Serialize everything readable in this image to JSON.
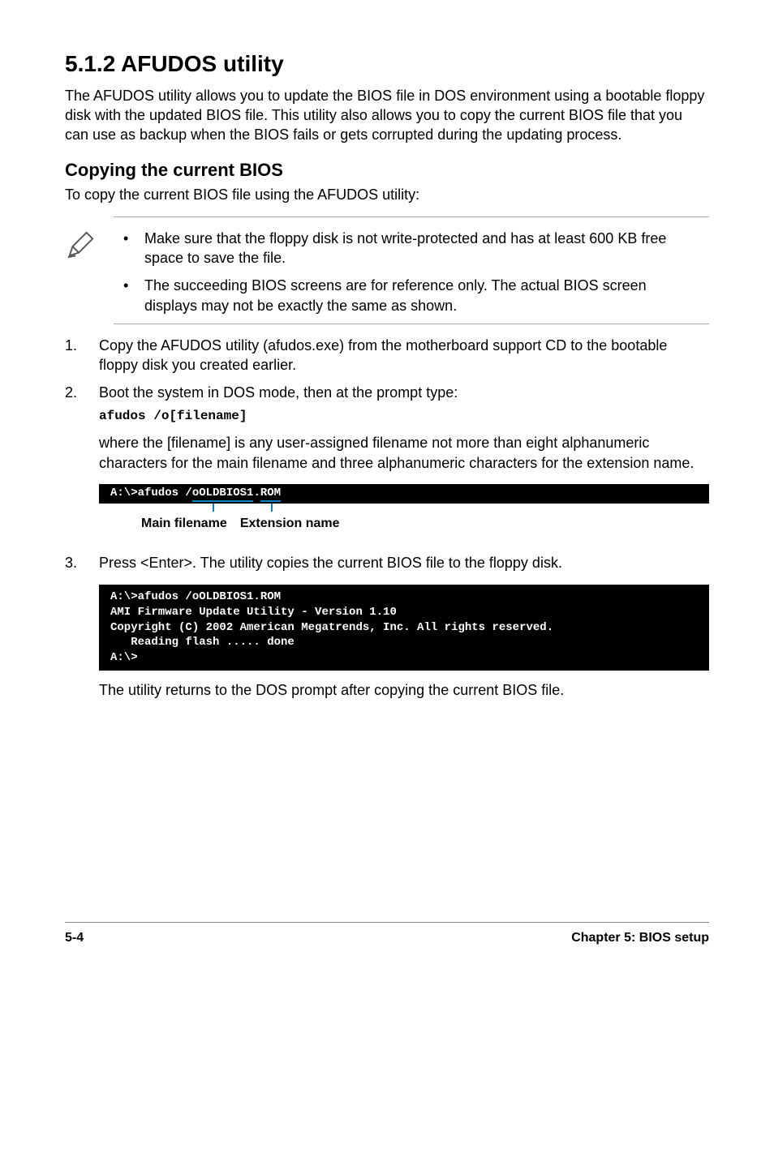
{
  "heading": "5.1.2   AFUDOS utility",
  "intro": "The AFUDOS utility allows you to update the BIOS file in DOS environment using a bootable floppy disk with the updated BIOS file. This utility also allows you to copy the current BIOS file that you can use as backup when the BIOS fails or gets corrupted during the updating process.",
  "sub_heading": "Copying the current BIOS",
  "sub_intro": "To copy the current BIOS file using the AFUDOS utility:",
  "notes": {
    "bullet": "•",
    "items": [
      "Make sure that the floppy disk is not write-protected and has at least 600 KB free space to save the file.",
      "The succeeding BIOS screens are for reference only. The actual BIOS screen displays may not be exactly the same as shown."
    ]
  },
  "steps": [
    {
      "num": "1.",
      "text": "Copy the AFUDOS utility (afudos.exe) from the motherboard support CD to the bootable floppy disk you created earlier."
    },
    {
      "num": "2.",
      "text": "Boot the system in DOS mode, then at the prompt type:",
      "code": "afudos /o[filename]",
      "after": "where the [filename] is any user-assigned filename not more than eight alphanumeric characters  for the main filename and three alphanumeric characters for the extension name.",
      "console": {
        "prefix": "A:\\>afudos /",
        "main": "oOLDBIOS1",
        "dot": ".",
        "ext": "ROM"
      },
      "labels": {
        "main": "Main filename",
        "ext": "Extension name"
      }
    },
    {
      "num": "3.",
      "text": "Press <Enter>. The utility copies the current BIOS file to the floppy disk.",
      "console_block": "A:\\>afudos /oOLDBIOS1.ROM\nAMI Firmware Update Utility - Version 1.10\nCopyright (C) 2002 American Megatrends, Inc. All rights reserved.\n   Reading flash ..... done\nA:\\>",
      "after2": "The utility returns to the DOS prompt after copying the current BIOS file."
    }
  ],
  "footer": {
    "left": "5-4",
    "right": "Chapter 5: BIOS setup"
  }
}
